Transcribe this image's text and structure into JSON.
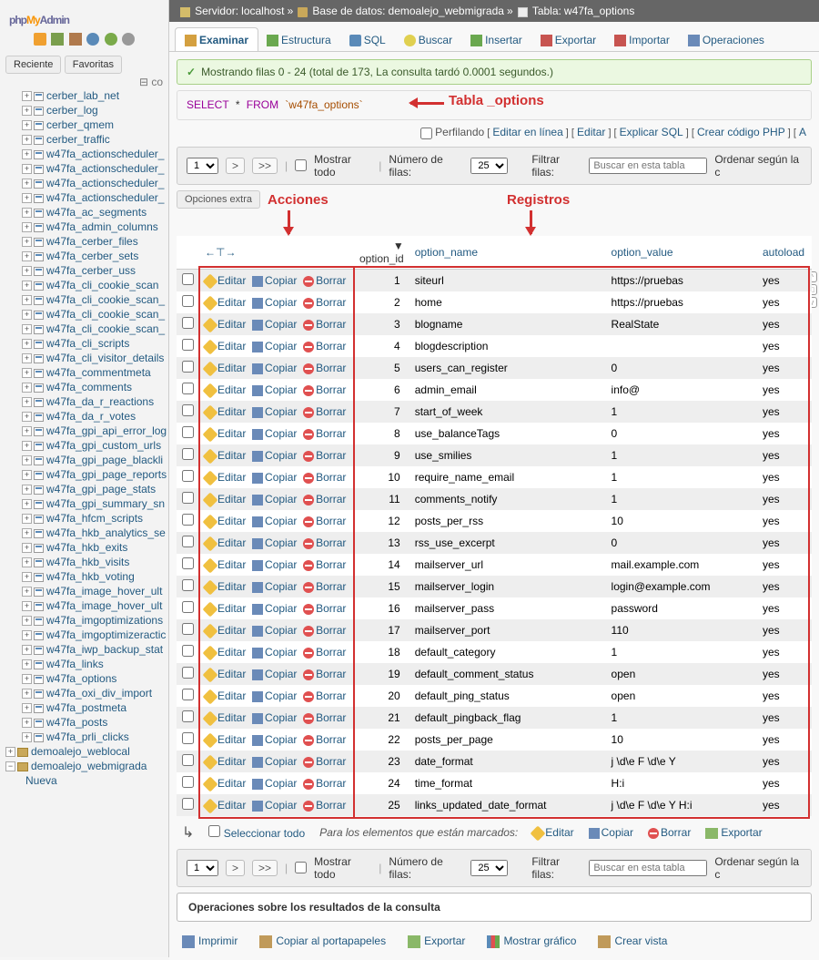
{
  "logo": {
    "p1": "php",
    "p2": "My",
    "p3": "Admin"
  },
  "nav_tabs": {
    "recent": "Reciente",
    "fav": "Favoritas"
  },
  "collapse_icon": "⊟ co",
  "tree_top_partial": {
    "label": "cerber_lab_net"
  },
  "tree_tables": [
    "cerber_log",
    "cerber_qmem",
    "cerber_traffic",
    "w47fa_actionscheduler_",
    "w47fa_actionscheduler_",
    "w47fa_actionscheduler_",
    "w47fa_actionscheduler_",
    "w47fa_ac_segments",
    "w47fa_admin_columns",
    "w47fa_cerber_files",
    "w47fa_cerber_sets",
    "w47fa_cerber_uss",
    "w47fa_cli_cookie_scan",
    "w47fa_cli_cookie_scan_",
    "w47fa_cli_cookie_scan_",
    "w47fa_cli_cookie_scan_",
    "w47fa_cli_scripts",
    "w47fa_cli_visitor_details",
    "w47fa_commentmeta",
    "w47fa_comments",
    "w47fa_da_r_reactions",
    "w47fa_da_r_votes",
    "w47fa_gpi_api_error_log",
    "w47fa_gpi_custom_urls",
    "w47fa_gpi_page_blackli",
    "w47fa_gpi_page_reports",
    "w47fa_gpi_page_stats",
    "w47fa_gpi_summary_sn",
    "w47fa_hfcm_scripts",
    "w47fa_hkb_analytics_se",
    "w47fa_hkb_exits",
    "w47fa_hkb_visits",
    "w47fa_hkb_voting",
    "w47fa_image_hover_ult",
    "w47fa_image_hover_ult",
    "w47fa_imgoptimizations",
    "w47fa_imgoptimizeractic",
    "w47fa_iwp_backup_stat",
    "w47fa_links",
    "w47fa_options",
    "w47fa_oxi_div_import",
    "w47fa_postmeta",
    "w47fa_posts",
    "w47fa_prli_clicks"
  ],
  "tree_dbs": [
    {
      "label": "demoalejo_weblocal",
      "expand": "+"
    },
    {
      "label": "demoalejo_webmigrada",
      "expand": "−"
    }
  ],
  "tree_new": "Nueva",
  "breadcrumb": {
    "server_lbl": "Servidor:",
    "server": "localhost",
    "db_lbl": "Base de datos:",
    "db": "demoalejo_webmigrada",
    "tbl_lbl": "Tabla:",
    "tbl": "w47fa_options",
    "sep": "»"
  },
  "tabs": [
    {
      "label": "Examinar",
      "ic": "ti-browse",
      "active": true
    },
    {
      "label": "Estructura",
      "ic": "ti-struct"
    },
    {
      "label": "SQL",
      "ic": "ti-sql"
    },
    {
      "label": "Buscar",
      "ic": "ti-search"
    },
    {
      "label": "Insertar",
      "ic": "ti-insert"
    },
    {
      "label": "Exportar",
      "ic": "ti-export"
    },
    {
      "label": "Importar",
      "ic": "ti-import"
    },
    {
      "label": "Operaciones",
      "ic": "ti-ops"
    }
  ],
  "success": "Mostrando filas 0 - 24 (total de 173, La consulta tardó 0.0001 segundos.)",
  "sql": {
    "select": "SELECT",
    "star": "*",
    "from": "FROM",
    "table": "`w47fa_options`"
  },
  "sql_actions": {
    "profiling": "Perfilando",
    "inline": "Editar en línea",
    "edit": "Editar",
    "explain": "Explicar SQL",
    "php": "Crear código PHP",
    "a": "A"
  },
  "annot": {
    "tabla": "Tabla _options",
    "acciones": "Acciones",
    "registros": "Registros"
  },
  "controls": {
    "page": "1",
    "next": ">",
    "last": ">>",
    "show_all": "Mostrar todo",
    "num_rows_lbl": "Número de filas:",
    "num_rows": "25",
    "filter_lbl": "Filtrar filas:",
    "filter_ph": "Buscar en esta tabla",
    "sort_lbl": "Ordenar según la c"
  },
  "extra_opts": "Opciones extra",
  "thead": {
    "arrows": "←⊤→",
    "option_id": "option_id",
    "option_name": "option_name",
    "option_value": "option_value",
    "autoload": "autoload",
    "sort_dir": "▼"
  },
  "row_actions": {
    "edit": "Editar",
    "copy": "Copiar",
    "delete": "Borrar"
  },
  "rows": [
    {
      "id": 1,
      "name": "siteurl",
      "value": "https://pruebas",
      "autoload": "yes"
    },
    {
      "id": 2,
      "name": "home",
      "value": "https://pruebas",
      "autoload": "yes"
    },
    {
      "id": 3,
      "name": "blogname",
      "value": "RealState",
      "autoload": "yes"
    },
    {
      "id": 4,
      "name": "blogdescription",
      "value": "",
      "autoload": "yes"
    },
    {
      "id": 5,
      "name": "users_can_register",
      "value": "0",
      "autoload": "yes"
    },
    {
      "id": 6,
      "name": "admin_email",
      "value": "info@",
      "autoload": "yes"
    },
    {
      "id": 7,
      "name": "start_of_week",
      "value": "1",
      "autoload": "yes"
    },
    {
      "id": 8,
      "name": "use_balanceTags",
      "value": "0",
      "autoload": "yes"
    },
    {
      "id": 9,
      "name": "use_smilies",
      "value": "1",
      "autoload": "yes"
    },
    {
      "id": 10,
      "name": "require_name_email",
      "value": "1",
      "autoload": "yes"
    },
    {
      "id": 11,
      "name": "comments_notify",
      "value": "1",
      "autoload": "yes"
    },
    {
      "id": 12,
      "name": "posts_per_rss",
      "value": "10",
      "autoload": "yes"
    },
    {
      "id": 13,
      "name": "rss_use_excerpt",
      "value": "0",
      "autoload": "yes"
    },
    {
      "id": 14,
      "name": "mailserver_url",
      "value": "mail.example.com",
      "autoload": "yes"
    },
    {
      "id": 15,
      "name": "mailserver_login",
      "value": "login@example.com",
      "autoload": "yes"
    },
    {
      "id": 16,
      "name": "mailserver_pass",
      "value": "password",
      "autoload": "yes"
    },
    {
      "id": 17,
      "name": "mailserver_port",
      "value": "110",
      "autoload": "yes"
    },
    {
      "id": 18,
      "name": "default_category",
      "value": "1",
      "autoload": "yes"
    },
    {
      "id": 19,
      "name": "default_comment_status",
      "value": "open",
      "autoload": "yes"
    },
    {
      "id": 20,
      "name": "default_ping_status",
      "value": "open",
      "autoload": "yes"
    },
    {
      "id": 21,
      "name": "default_pingback_flag",
      "value": "1",
      "autoload": "yes"
    },
    {
      "id": 22,
      "name": "posts_per_page",
      "value": "10",
      "autoload": "yes"
    },
    {
      "id": 23,
      "name": "date_format",
      "value": "j \\d\\e F \\d\\e Y",
      "autoload": "yes"
    },
    {
      "id": 24,
      "name": "time_format",
      "value": "H:i",
      "autoload": "yes"
    },
    {
      "id": 25,
      "name": "links_updated_date_format",
      "value": "j \\d\\e F \\d\\e Y H:i",
      "autoload": "yes"
    }
  ],
  "check_all": {
    "arrow": "↳",
    "check": "Seleccionar todo",
    "hint": "Para los elementos que están marcados:",
    "edit": "Editar",
    "copy": "Copiar",
    "delete": "Borrar",
    "export": "Exportar"
  },
  "query_ops_title": "Operaciones sobre los resultados de la consulta",
  "result_ops": [
    {
      "label": "Imprimir",
      "ic": "ri-print"
    },
    {
      "label": "Copiar al portapapeles",
      "ic": "ri-clip"
    },
    {
      "label": "Exportar",
      "ic": "ri-exp"
    },
    {
      "label": "Mostrar gráfico",
      "ic": "ri-chart"
    },
    {
      "label": "Crear vista",
      "ic": "ri-view"
    }
  ]
}
